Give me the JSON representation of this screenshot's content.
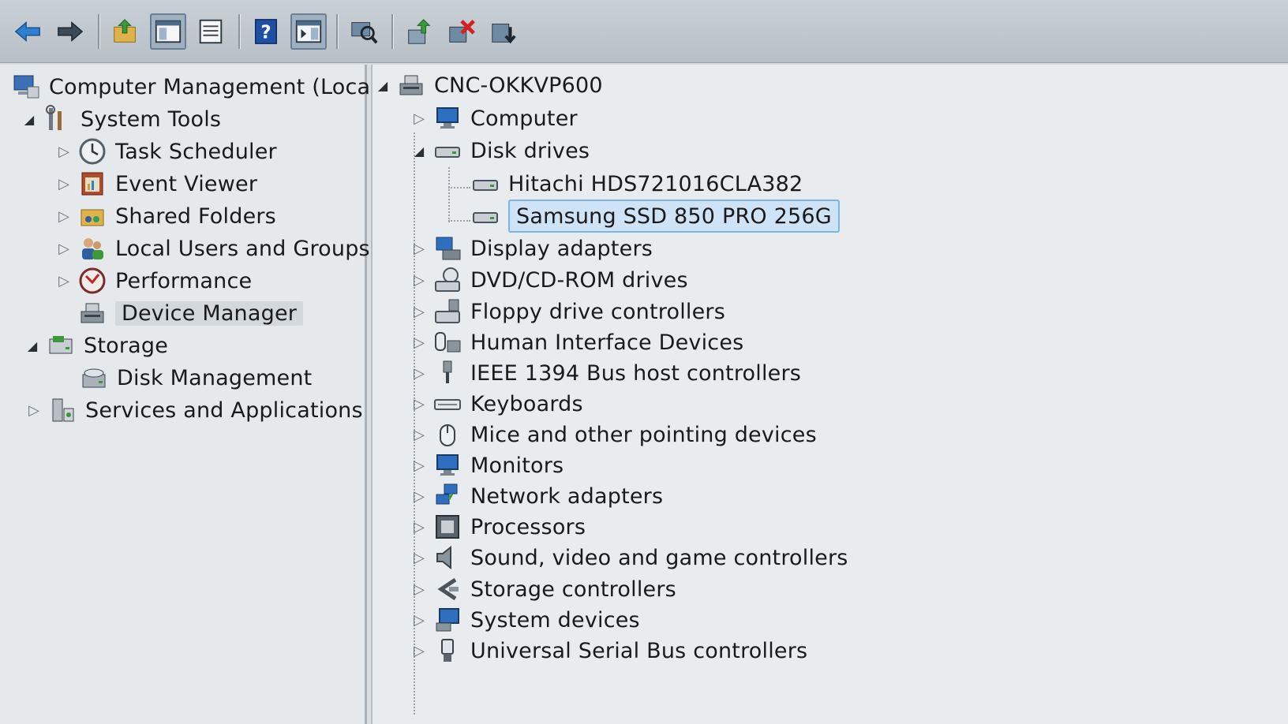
{
  "toolbar": {
    "buttons": [
      {
        "name": "back-arrow-icon"
      },
      {
        "name": "forward-arrow-icon"
      },
      {
        "name": "up-folder-icon"
      },
      {
        "name": "show-hide-console-tree-icon"
      },
      {
        "name": "properties-icon"
      },
      {
        "name": "help-icon"
      },
      {
        "name": "show-hide-action-pane-icon"
      },
      {
        "name": "scan-hardware-icon"
      },
      {
        "name": "update-driver-icon"
      },
      {
        "name": "uninstall-device-icon"
      },
      {
        "name": "add-legacy-hardware-icon"
      }
    ]
  },
  "left_tree": {
    "root": "Computer Management (Local",
    "system_tools": "System Tools",
    "task_scheduler": "Task Scheduler",
    "event_viewer": "Event Viewer",
    "shared_folders": "Shared Folders",
    "local_users": "Local Users and Groups",
    "performance": "Performance",
    "device_manager": "Device Manager",
    "storage": "Storage",
    "disk_management": "Disk Management",
    "services": "Services and Applications"
  },
  "device_tree": {
    "root": "CNC-OKKVP600",
    "computer": "Computer",
    "disk_drives": "Disk drives",
    "disk_1": "Hitachi HDS721016CLA382",
    "disk_2": "Samsung SSD 850 PRO 256G",
    "display_adapters": "Display adapters",
    "dvd": "DVD/CD-ROM drives",
    "floppy": "Floppy drive controllers",
    "hid": "Human Interface Devices",
    "ieee": "IEEE 1394 Bus host controllers",
    "keyboards": "Keyboards",
    "mice": "Mice and other pointing devices",
    "monitors": "Monitors",
    "network": "Network adapters",
    "processors": "Processors",
    "sound": "Sound, video and game controllers",
    "storage_ctrl": "Storage controllers",
    "system_devices": "System devices",
    "usb": "Universal Serial Bus controllers"
  },
  "colors": {
    "selection_highlight": "#cfe3f7",
    "selection_border": "#7eb4e6",
    "toolbar_bg": "#c0c7cd"
  }
}
